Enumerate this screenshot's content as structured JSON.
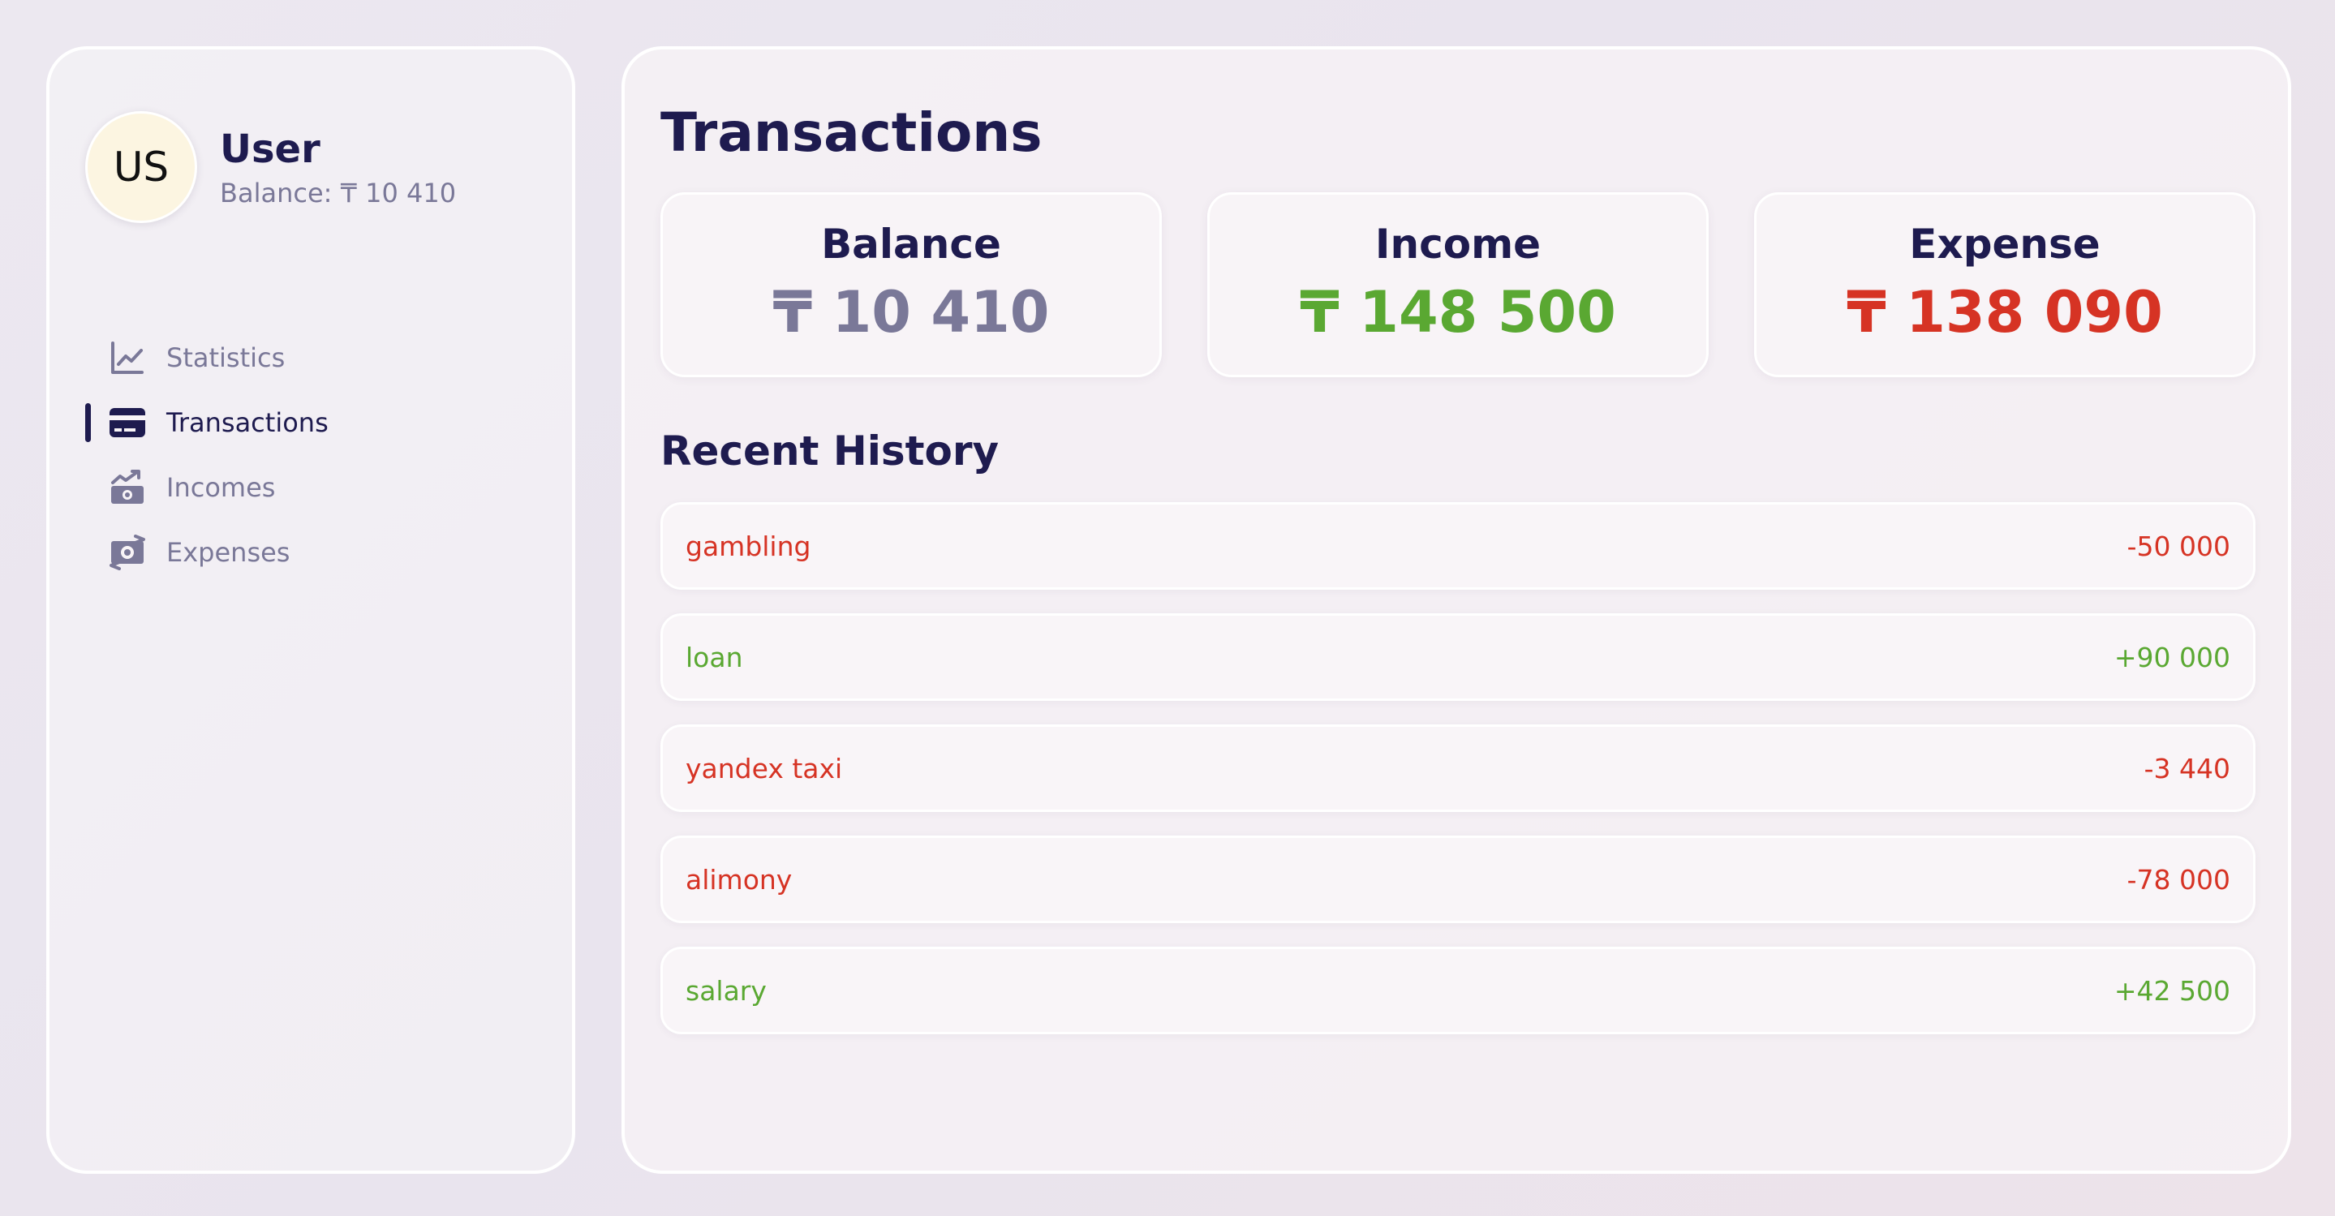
{
  "colors": {
    "primary": "#1e1b4f",
    "muted": "#7a7898",
    "income": "#5aa832",
    "expense": "#d63324",
    "avatar_bg": "#fcf5e1"
  },
  "user": {
    "initials": "US",
    "name": "User",
    "balance_label": "Balance: ₸ 10 410"
  },
  "nav": {
    "items": [
      {
        "label": "Statistics",
        "icon": "chart-line-icon",
        "active": false
      },
      {
        "label": "Transactions",
        "icon": "credit-card-icon",
        "active": true
      },
      {
        "label": "Incomes",
        "icon": "money-bill-trend-up-icon",
        "active": false
      },
      {
        "label": "Expenses",
        "icon": "money-bill-transfer-icon",
        "active": false
      }
    ]
  },
  "main": {
    "title": "Transactions",
    "summary": {
      "balance": {
        "label": "Balance",
        "value": "₸ 10 410"
      },
      "income": {
        "label": "Income",
        "value": "₸ 148 500"
      },
      "expense": {
        "label": "Expense",
        "value": "₸ 138 090"
      }
    },
    "history_title": "Recent History",
    "history": [
      {
        "name": "gambling",
        "amount": "-50 000",
        "type": "expense"
      },
      {
        "name": "loan",
        "amount": "+90 000",
        "type": "income"
      },
      {
        "name": "yandex taxi",
        "amount": "-3 440",
        "type": "expense"
      },
      {
        "name": "alimony",
        "amount": "-78 000",
        "type": "expense"
      },
      {
        "name": "salary",
        "amount": "+42 500",
        "type": "income"
      }
    ]
  }
}
